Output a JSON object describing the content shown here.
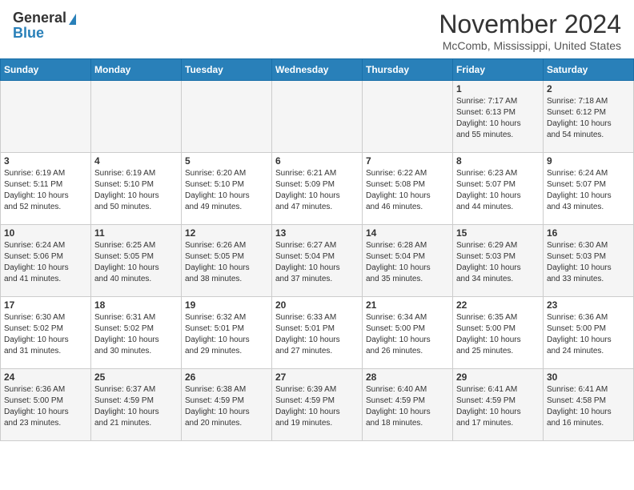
{
  "header": {
    "logo_general": "General",
    "logo_blue": "Blue",
    "month_title": "November 2024",
    "location": "McComb, Mississippi, United States"
  },
  "calendar": {
    "days_of_week": [
      "Sunday",
      "Monday",
      "Tuesday",
      "Wednesday",
      "Thursday",
      "Friday",
      "Saturday"
    ],
    "weeks": [
      [
        {
          "day": "",
          "info": ""
        },
        {
          "day": "",
          "info": ""
        },
        {
          "day": "",
          "info": ""
        },
        {
          "day": "",
          "info": ""
        },
        {
          "day": "",
          "info": ""
        },
        {
          "day": "1",
          "info": "Sunrise: 7:17 AM\nSunset: 6:13 PM\nDaylight: 10 hours\nand 55 minutes."
        },
        {
          "day": "2",
          "info": "Sunrise: 7:18 AM\nSunset: 6:12 PM\nDaylight: 10 hours\nand 54 minutes."
        }
      ],
      [
        {
          "day": "3",
          "info": "Sunrise: 6:19 AM\nSunset: 5:11 PM\nDaylight: 10 hours\nand 52 minutes."
        },
        {
          "day": "4",
          "info": "Sunrise: 6:19 AM\nSunset: 5:10 PM\nDaylight: 10 hours\nand 50 minutes."
        },
        {
          "day": "5",
          "info": "Sunrise: 6:20 AM\nSunset: 5:10 PM\nDaylight: 10 hours\nand 49 minutes."
        },
        {
          "day": "6",
          "info": "Sunrise: 6:21 AM\nSunset: 5:09 PM\nDaylight: 10 hours\nand 47 minutes."
        },
        {
          "day": "7",
          "info": "Sunrise: 6:22 AM\nSunset: 5:08 PM\nDaylight: 10 hours\nand 46 minutes."
        },
        {
          "day": "8",
          "info": "Sunrise: 6:23 AM\nSunset: 5:07 PM\nDaylight: 10 hours\nand 44 minutes."
        },
        {
          "day": "9",
          "info": "Sunrise: 6:24 AM\nSunset: 5:07 PM\nDaylight: 10 hours\nand 43 minutes."
        }
      ],
      [
        {
          "day": "10",
          "info": "Sunrise: 6:24 AM\nSunset: 5:06 PM\nDaylight: 10 hours\nand 41 minutes."
        },
        {
          "day": "11",
          "info": "Sunrise: 6:25 AM\nSunset: 5:05 PM\nDaylight: 10 hours\nand 40 minutes."
        },
        {
          "day": "12",
          "info": "Sunrise: 6:26 AM\nSunset: 5:05 PM\nDaylight: 10 hours\nand 38 minutes."
        },
        {
          "day": "13",
          "info": "Sunrise: 6:27 AM\nSunset: 5:04 PM\nDaylight: 10 hours\nand 37 minutes."
        },
        {
          "day": "14",
          "info": "Sunrise: 6:28 AM\nSunset: 5:04 PM\nDaylight: 10 hours\nand 35 minutes."
        },
        {
          "day": "15",
          "info": "Sunrise: 6:29 AM\nSunset: 5:03 PM\nDaylight: 10 hours\nand 34 minutes."
        },
        {
          "day": "16",
          "info": "Sunrise: 6:30 AM\nSunset: 5:03 PM\nDaylight: 10 hours\nand 33 minutes."
        }
      ],
      [
        {
          "day": "17",
          "info": "Sunrise: 6:30 AM\nSunset: 5:02 PM\nDaylight: 10 hours\nand 31 minutes."
        },
        {
          "day": "18",
          "info": "Sunrise: 6:31 AM\nSunset: 5:02 PM\nDaylight: 10 hours\nand 30 minutes."
        },
        {
          "day": "19",
          "info": "Sunrise: 6:32 AM\nSunset: 5:01 PM\nDaylight: 10 hours\nand 29 minutes."
        },
        {
          "day": "20",
          "info": "Sunrise: 6:33 AM\nSunset: 5:01 PM\nDaylight: 10 hours\nand 27 minutes."
        },
        {
          "day": "21",
          "info": "Sunrise: 6:34 AM\nSunset: 5:00 PM\nDaylight: 10 hours\nand 26 minutes."
        },
        {
          "day": "22",
          "info": "Sunrise: 6:35 AM\nSunset: 5:00 PM\nDaylight: 10 hours\nand 25 minutes."
        },
        {
          "day": "23",
          "info": "Sunrise: 6:36 AM\nSunset: 5:00 PM\nDaylight: 10 hours\nand 24 minutes."
        }
      ],
      [
        {
          "day": "24",
          "info": "Sunrise: 6:36 AM\nSunset: 5:00 PM\nDaylight: 10 hours\nand 23 minutes."
        },
        {
          "day": "25",
          "info": "Sunrise: 6:37 AM\nSunset: 4:59 PM\nDaylight: 10 hours\nand 21 minutes."
        },
        {
          "day": "26",
          "info": "Sunrise: 6:38 AM\nSunset: 4:59 PM\nDaylight: 10 hours\nand 20 minutes."
        },
        {
          "day": "27",
          "info": "Sunrise: 6:39 AM\nSunset: 4:59 PM\nDaylight: 10 hours\nand 19 minutes."
        },
        {
          "day": "28",
          "info": "Sunrise: 6:40 AM\nSunset: 4:59 PM\nDaylight: 10 hours\nand 18 minutes."
        },
        {
          "day": "29",
          "info": "Sunrise: 6:41 AM\nSunset: 4:59 PM\nDaylight: 10 hours\nand 17 minutes."
        },
        {
          "day": "30",
          "info": "Sunrise: 6:41 AM\nSunset: 4:58 PM\nDaylight: 10 hours\nand 16 minutes."
        }
      ]
    ]
  }
}
